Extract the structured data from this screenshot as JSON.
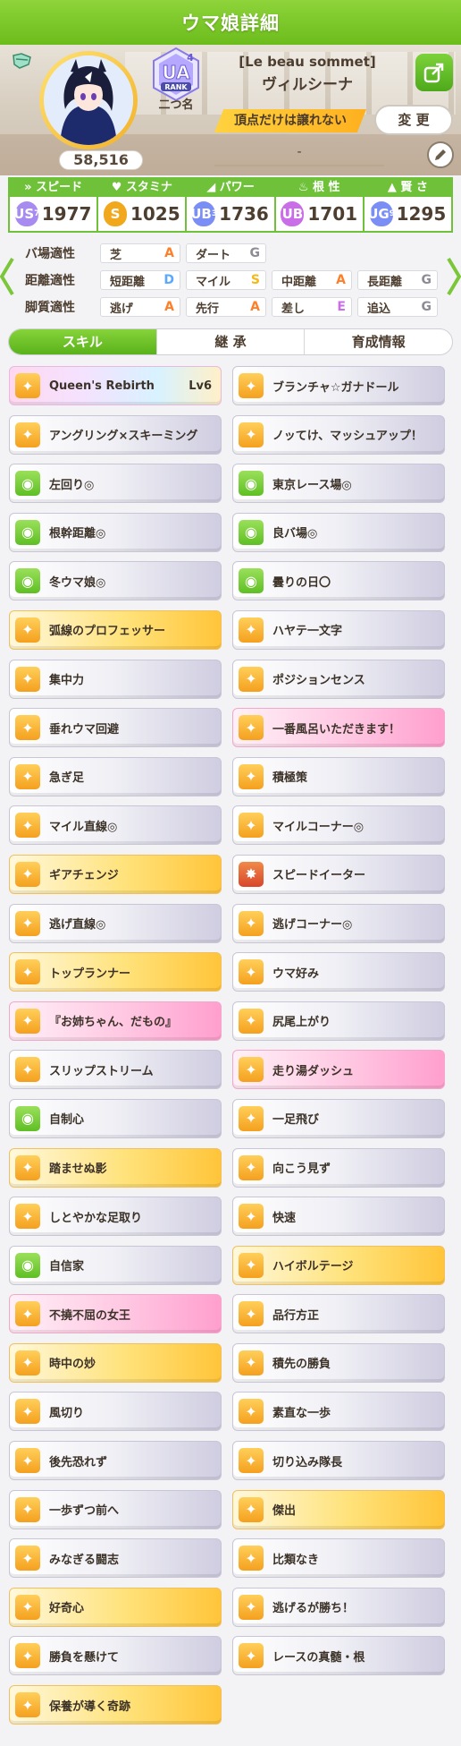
{
  "header": {
    "title": "ウマ娘詳細"
  },
  "profile": {
    "fans": "58,516",
    "rank_letters": "UA",
    "rank_number": "4",
    "rank_word": "RANK",
    "rank_name": "二つ名",
    "subtitle": "[Le beau sommet]",
    "name": "ヴィルシーナ",
    "motto": "頂点だけは譲れない",
    "change_label": "変 更",
    "memo": "-"
  },
  "stats": [
    {
      "label": "スピード",
      "icon": "shoe-icon",
      "grade": "US",
      "grade_num": "7",
      "value": "1977",
      "color": "#a78bf0"
    },
    {
      "label": "スタミナ",
      "icon": "heart-icon",
      "grade": "S",
      "grade_num": "",
      "value": "1025",
      "color": "#f2a81d"
    },
    {
      "label": "パワー",
      "icon": "arm-icon",
      "grade": "UB",
      "grade_num": "3",
      "value": "1736",
      "color": "#7a8ef5"
    },
    {
      "label": "根 性",
      "icon": "flame-icon",
      "grade": "UB",
      "grade_num": "",
      "value": "1701",
      "color": "#c96ee8"
    },
    {
      "label": "賢 さ",
      "icon": "cap-icon",
      "grade": "UG",
      "grade_num": "9",
      "value": "1295",
      "color": "#7a8ef5"
    }
  ],
  "aptitudes": [
    {
      "label": "バ場適性",
      "cells": [
        {
          "name": "芝",
          "grade": "A",
          "color": "#ff7f28"
        },
        {
          "name": "ダート",
          "grade": "G",
          "color": "#8c8c96"
        }
      ]
    },
    {
      "label": "距離適性",
      "cells": [
        {
          "name": "短距離",
          "grade": "D",
          "color": "#5aa8ff"
        },
        {
          "name": "マイル",
          "grade": "S",
          "color": "#f5b81a"
        },
        {
          "name": "中距離",
          "grade": "A",
          "color": "#ff7f28"
        },
        {
          "name": "長距離",
          "grade": "G",
          "color": "#8c8c96"
        }
      ]
    },
    {
      "label": "脚質適性",
      "cells": [
        {
          "name": "逃げ",
          "grade": "A",
          "color": "#ff7f28"
        },
        {
          "name": "先行",
          "grade": "A",
          "color": "#ff7f28"
        },
        {
          "name": "差し",
          "grade": "E",
          "color": "#c96ee8"
        },
        {
          "name": "追込",
          "grade": "G",
          "color": "#8c8c96"
        }
      ]
    }
  ],
  "tabs": [
    {
      "label": "スキル",
      "active": true
    },
    {
      "label": "継 承",
      "active": false
    },
    {
      "label": "育成情報",
      "active": false
    }
  ],
  "skills": [
    {
      "name": "Queen's Rebirth",
      "level": "Lv6",
      "style": "unique",
      "icon": "speed"
    },
    {
      "name": "ブランチャ☆ガナドール",
      "level": "",
      "style": "white",
      "icon": "speed"
    },
    {
      "name": "アングリング×スキーミング",
      "level": "",
      "style": "white",
      "icon": "speed"
    },
    {
      "name": "ノッてけ、マッシュアップ！",
      "level": "",
      "style": "white",
      "icon": "speed"
    },
    {
      "name": "左回り◎",
      "level": "",
      "style": "white",
      "icon": "heal"
    },
    {
      "name": "東京レース場◎",
      "level": "",
      "style": "white",
      "icon": "heal"
    },
    {
      "name": "根幹距離◎",
      "level": "",
      "style": "white",
      "icon": "heal"
    },
    {
      "name": "良バ場◎",
      "level": "",
      "style": "white",
      "icon": "heal"
    },
    {
      "name": "冬ウマ娘◎",
      "level": "",
      "style": "white",
      "icon": "heal"
    },
    {
      "name": "曇りの日〇",
      "level": "",
      "style": "white",
      "icon": "heal"
    },
    {
      "name": "弧線のプロフェッサー",
      "level": "",
      "style": "gold",
      "icon": "speed"
    },
    {
      "name": "ハヤテ一文字",
      "level": "",
      "style": "white",
      "icon": "speed"
    },
    {
      "name": "集中力",
      "level": "",
      "style": "white",
      "icon": "speed"
    },
    {
      "name": "ポジションセンス",
      "level": "",
      "style": "white",
      "icon": "speed"
    },
    {
      "name": "垂れウマ回避",
      "level": "",
      "style": "white",
      "icon": "speed"
    },
    {
      "name": "一番風呂いただきます！",
      "level": "",
      "style": "pink",
      "icon": "speed"
    },
    {
      "name": "急ぎ足",
      "level": "",
      "style": "white",
      "icon": "speed"
    },
    {
      "name": "積極策",
      "level": "",
      "style": "white",
      "icon": "speed"
    },
    {
      "name": "マイル直線◎",
      "level": "",
      "style": "white",
      "icon": "speed"
    },
    {
      "name": "マイルコーナー◎",
      "level": "",
      "style": "white",
      "icon": "speed"
    },
    {
      "name": "ギアチェンジ",
      "level": "",
      "style": "gold",
      "icon": "speed"
    },
    {
      "name": "スピードイーター",
      "level": "",
      "style": "white",
      "icon": "red"
    },
    {
      "name": "逃げ直線◎",
      "level": "",
      "style": "white",
      "icon": "speed"
    },
    {
      "name": "逃げコーナー◎",
      "level": "",
      "style": "white",
      "icon": "speed"
    },
    {
      "name": "トップランナー",
      "level": "",
      "style": "gold",
      "icon": "speed"
    },
    {
      "name": "ウマ好み",
      "level": "",
      "style": "white",
      "icon": "speed"
    },
    {
      "name": "『お姉ちゃん、だもの』",
      "level": "",
      "style": "pink",
      "icon": "speed"
    },
    {
      "name": "尻尾上がり",
      "level": "",
      "style": "white",
      "icon": "speed"
    },
    {
      "name": "スリップストリーム",
      "level": "",
      "style": "white",
      "icon": "speed"
    },
    {
      "name": "走り湯ダッシュ",
      "level": "",
      "style": "pink",
      "icon": "speed"
    },
    {
      "name": "自制心",
      "level": "",
      "style": "white",
      "icon": "heal"
    },
    {
      "name": "一足飛び",
      "level": "",
      "style": "white",
      "icon": "speed"
    },
    {
      "name": "踏ませぬ影",
      "level": "",
      "style": "gold",
      "icon": "speed"
    },
    {
      "name": "向こう見ず",
      "level": "",
      "style": "white",
      "icon": "speed"
    },
    {
      "name": "しとやかな足取り",
      "level": "",
      "style": "white",
      "icon": "speed"
    },
    {
      "name": "快速",
      "level": "",
      "style": "white",
      "icon": "speed"
    },
    {
      "name": "自信家",
      "level": "",
      "style": "white",
      "icon": "heal"
    },
    {
      "name": "ハイボルテージ",
      "level": "",
      "style": "gold",
      "icon": "speed"
    },
    {
      "name": "不撓不屈の女王",
      "level": "",
      "style": "pink",
      "icon": "speed"
    },
    {
      "name": "品行方正",
      "level": "",
      "style": "white",
      "icon": "speed"
    },
    {
      "name": "時中の妙",
      "level": "",
      "style": "gold",
      "icon": "speed"
    },
    {
      "name": "積先の勝負",
      "level": "",
      "style": "white",
      "icon": "speed"
    },
    {
      "name": "風切り",
      "level": "",
      "style": "white",
      "icon": "speed"
    },
    {
      "name": "素直な一歩",
      "level": "",
      "style": "white",
      "icon": "speed"
    },
    {
      "name": "後先恐れず",
      "level": "",
      "style": "white",
      "icon": "speed"
    },
    {
      "name": "切り込み隊長",
      "level": "",
      "style": "white",
      "icon": "speed"
    },
    {
      "name": "一歩ずつ前へ",
      "level": "",
      "style": "white",
      "icon": "speed"
    },
    {
      "name": "傑出",
      "level": "",
      "style": "gold",
      "icon": "speed"
    },
    {
      "name": "みなぎる闘志",
      "level": "",
      "style": "white",
      "icon": "speed"
    },
    {
      "name": "比類なき",
      "level": "",
      "style": "white",
      "icon": "speed"
    },
    {
      "name": "好奇心",
      "level": "",
      "style": "gold",
      "icon": "speed"
    },
    {
      "name": "逃げるが勝ち！",
      "level": "",
      "style": "white",
      "icon": "speed"
    },
    {
      "name": "勝負を懸けて",
      "level": "",
      "style": "white",
      "icon": "speed"
    },
    {
      "name": "レースの真髄・根",
      "level": "",
      "style": "white",
      "icon": "speed"
    },
    {
      "name": "保養が導く奇跡",
      "level": "",
      "style": "gold",
      "icon": "speed"
    }
  ]
}
